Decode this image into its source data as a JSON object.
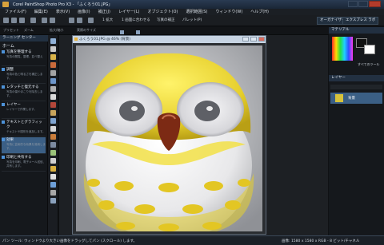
{
  "app": {
    "title": "Corel PaintShop Photo Pro X3 - 「ふくろう01.JPG」"
  },
  "menu": [
    "ファイル(F)",
    "編集(E)",
    "表示(V)",
    "画像(I)",
    "補正(J)",
    "レイヤー(L)",
    "オブジェクト(O)",
    "選択範囲(S)",
    "ウィンドウ(W)",
    "ヘルプ(H)"
  ],
  "toolbar": {
    "zoom_in_label": "1 拡大",
    "zoom_fit_label": "1 画面に合わせる",
    "adjust_label": "写真の補正",
    "palette_label": "パレット(P)",
    "organizer_button": "オーガナイザー",
    "express_button": "エクスプレス ラボ"
  },
  "options": {
    "label_1": "プリセット",
    "label_2": "ズーム",
    "label_3": "拡大/縮小",
    "label_4": "実際のサイズ"
  },
  "learning_center": {
    "header": "ラーニング センター",
    "home": "ホーム",
    "items": [
      {
        "title": "写真を整理する",
        "desc": "写真の閲覧、整理、並べ替え"
      },
      {
        "title": "調整",
        "desc": "写真の色と明るさを補正します。"
      },
      {
        "title": "レタッチと復元する",
        "desc": "写真の傷やほこりを除去します。"
      },
      {
        "title": "レイヤー",
        "desc": "レイヤーで作業します。"
      },
      {
        "title": "テキストとグラフィック",
        "desc": "テキストや図形を追加します。"
      },
      {
        "title": "効果",
        "desc": "写真に芸術的な効果を適用します。"
      },
      {
        "title": "印刷と共有する",
        "desc": "写真を印刷、電子メール送信、共有します。"
      }
    ]
  },
  "document": {
    "title": "ふくろう01.JPG @ 46% (背景)"
  },
  "panels": {
    "materials": "マテリアル",
    "all_tools": "すべてのツール",
    "layers": "レイヤー",
    "layer_name": "背景"
  },
  "status": {
    "message": "パン ツール: ウィンドウより大きい画像をドラッグしてパン (スクロール) します。",
    "image_info": "画像: 1580 x 1580 x RGB - 8 ビット/チャネル"
  },
  "colors": {
    "accent": "#3b5f85",
    "owl_yellow": "#e8d234",
    "beak": "#7c2a14"
  }
}
